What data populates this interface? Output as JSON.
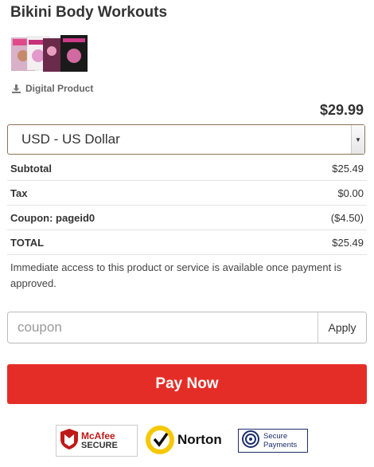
{
  "product": {
    "title": "Bikini Body Workouts",
    "type_label": "Digital Product",
    "price": "$29.99",
    "image_alt": "product covers"
  },
  "currency": {
    "selected": "USD - US Dollar"
  },
  "summary": [
    {
      "label": "Subtotal",
      "value": "$25.49"
    },
    {
      "label": "Tax",
      "value": "$0.00"
    },
    {
      "label": "Coupon: pageid0",
      "value": "($4.50)"
    },
    {
      "label": "TOTAL",
      "value": "$25.49"
    }
  ],
  "note": "Immediate access to this product or service is available once payment is approved.",
  "coupon": {
    "placeholder": "coupon",
    "apply_label": "Apply"
  },
  "pay_button_label": "Pay Now",
  "badges": {
    "mcafee_brand": "McAfee",
    "mcafee_sub": "SECURE",
    "norton": "Norton",
    "secure_line1": "Secure",
    "secure_line2": "Payments"
  },
  "colors": {
    "pay_button": "#e52d27",
    "currency_border": "#8b7355"
  }
}
